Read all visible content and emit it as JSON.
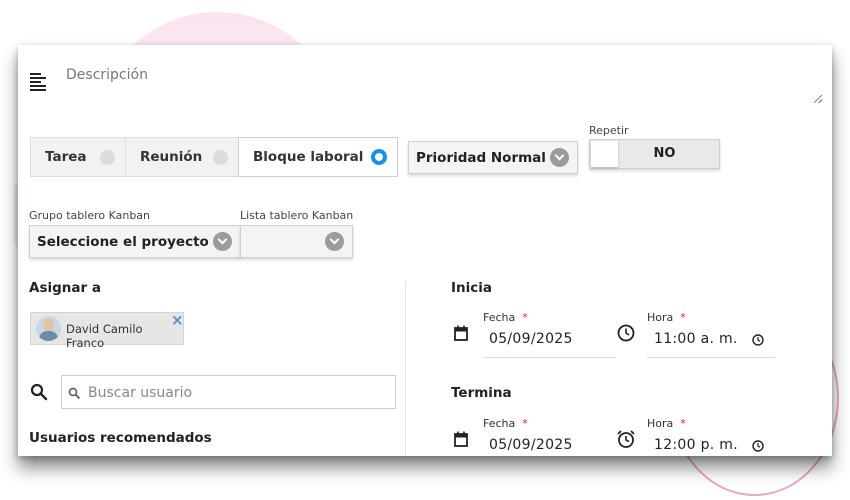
{
  "description": {
    "label": "Descripción"
  },
  "event_types": [
    {
      "label": "Tarea",
      "selected": false
    },
    {
      "label": "Reunión",
      "selected": false
    },
    {
      "label": "Bloque laboral",
      "selected": true
    }
  ],
  "priority": {
    "value": "Prioridad Normal"
  },
  "repeat": {
    "label": "Repetir",
    "value": "NO"
  },
  "kanban": {
    "group_label": "Grupo tablero Kanban",
    "group_value": "Seleccione el proyecto",
    "list_label": "Lista tablero Kanban",
    "list_value": ""
  },
  "assign": {
    "title": "Asignar a",
    "assigned_user": "David Camilo Franco",
    "search_placeholder": "Buscar usuario",
    "recommended_title": "Usuarios recomendados"
  },
  "start": {
    "title": "Inicia",
    "date_label": "Fecha",
    "date_value": "05/09/2025",
    "time_label": "Hora",
    "time_value": "11:00 a. m.",
    "required_mark": "*"
  },
  "end": {
    "title": "Termina",
    "date_label": "Fecha",
    "date_value": "05/09/2025",
    "time_label": "Hora",
    "time_value": "12:00 p. m.",
    "required_mark": "*"
  },
  "colors": {
    "accent": "#1a8fe3",
    "required": "#e0222f",
    "chip_close": "#5b8fc9"
  }
}
